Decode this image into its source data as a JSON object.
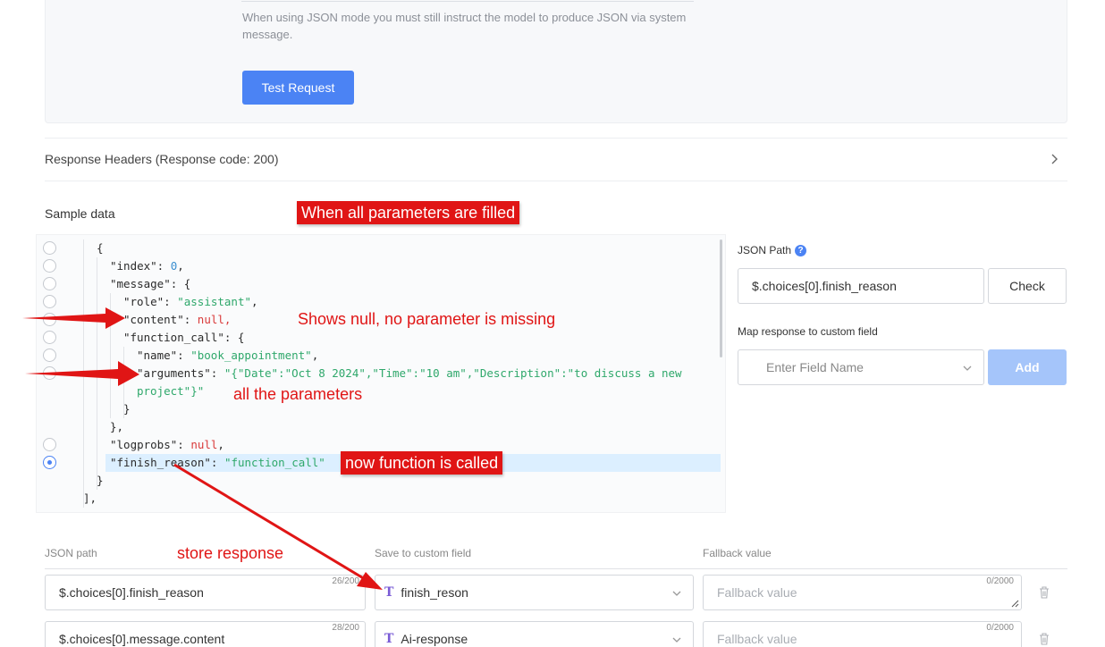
{
  "top": {
    "json_mode_note": "When using JSON mode you must still instruct the model to produce JSON via system message.",
    "test_request_label": "Test Request"
  },
  "response_headers": {
    "label": "Response Headers (Response code: 200)"
  },
  "sample": {
    "title": "Sample data",
    "selected_line": 12
  },
  "json_path_panel": {
    "label": "JSON Path",
    "value": "$.choices[0].finish_reason",
    "check_label": "Check",
    "map_label": "Map response to custom field",
    "field_placeholder": "Enter Field Name",
    "add_label": "Add"
  },
  "mapping_table": {
    "headers": {
      "json_path": "JSON path",
      "custom_field": "Save to custom field",
      "fallback": "Fallback value"
    },
    "rows": [
      {
        "json_path": "$.choices[0].finish_reason",
        "json_path_count": "26/200",
        "custom_field": "finish_reson",
        "fallback_placeholder": "Fallback value",
        "fallback_count": "0/2000"
      },
      {
        "json_path": "$.choices[0].message.content",
        "json_path_count": "28/200",
        "custom_field": "Ai-response",
        "fallback_placeholder": "Fallback value",
        "fallback_count": "0/2000"
      }
    ]
  },
  "annotations": {
    "all_params_filled": "When all parameters are filled",
    "shows_null": "Shows null, no parameter is missing",
    "all_parameters": "all the parameters",
    "function_called": "now function is called",
    "store_response": "store response"
  },
  "colors": {
    "accent": "#4b83f4",
    "annotation_red": "#e01515",
    "string_green": "#2fa86b",
    "null_red": "#d93a3a",
    "number_blue": "#3b8fd0"
  }
}
